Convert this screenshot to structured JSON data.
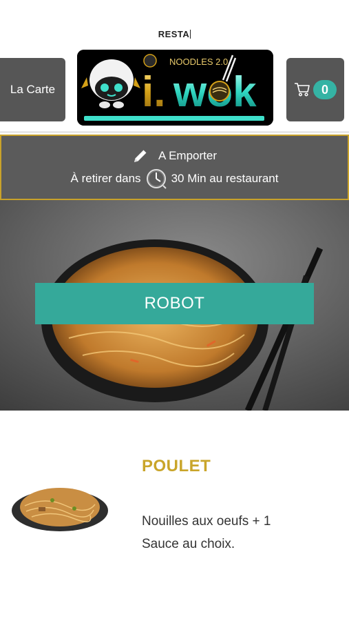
{
  "header": {
    "top_text": "RESTA",
    "menu_button": "La Carte",
    "logo": {
      "text_main": "i.wok",
      "text_small": "NOODLES 2.0",
      "icon": "robot-mascot-icon"
    },
    "cart": {
      "icon": "cart-icon",
      "count": "0"
    }
  },
  "order_info": {
    "mode_icon": "pencil-icon",
    "mode_label": "A Emporter",
    "pickup_prefix": "À retirer dans",
    "clock_icon": "clock-icon",
    "pickup_suffix": "30 Min au restaurant"
  },
  "hero": {
    "label": "ROBOT"
  },
  "product": {
    "title": "POULET",
    "description": "Nouilles aux oeufs + 1 Sauce au choix."
  },
  "colors": {
    "accent_teal": "#35b3a4",
    "button_grey": "#565656",
    "gold": "#c9a52a"
  }
}
